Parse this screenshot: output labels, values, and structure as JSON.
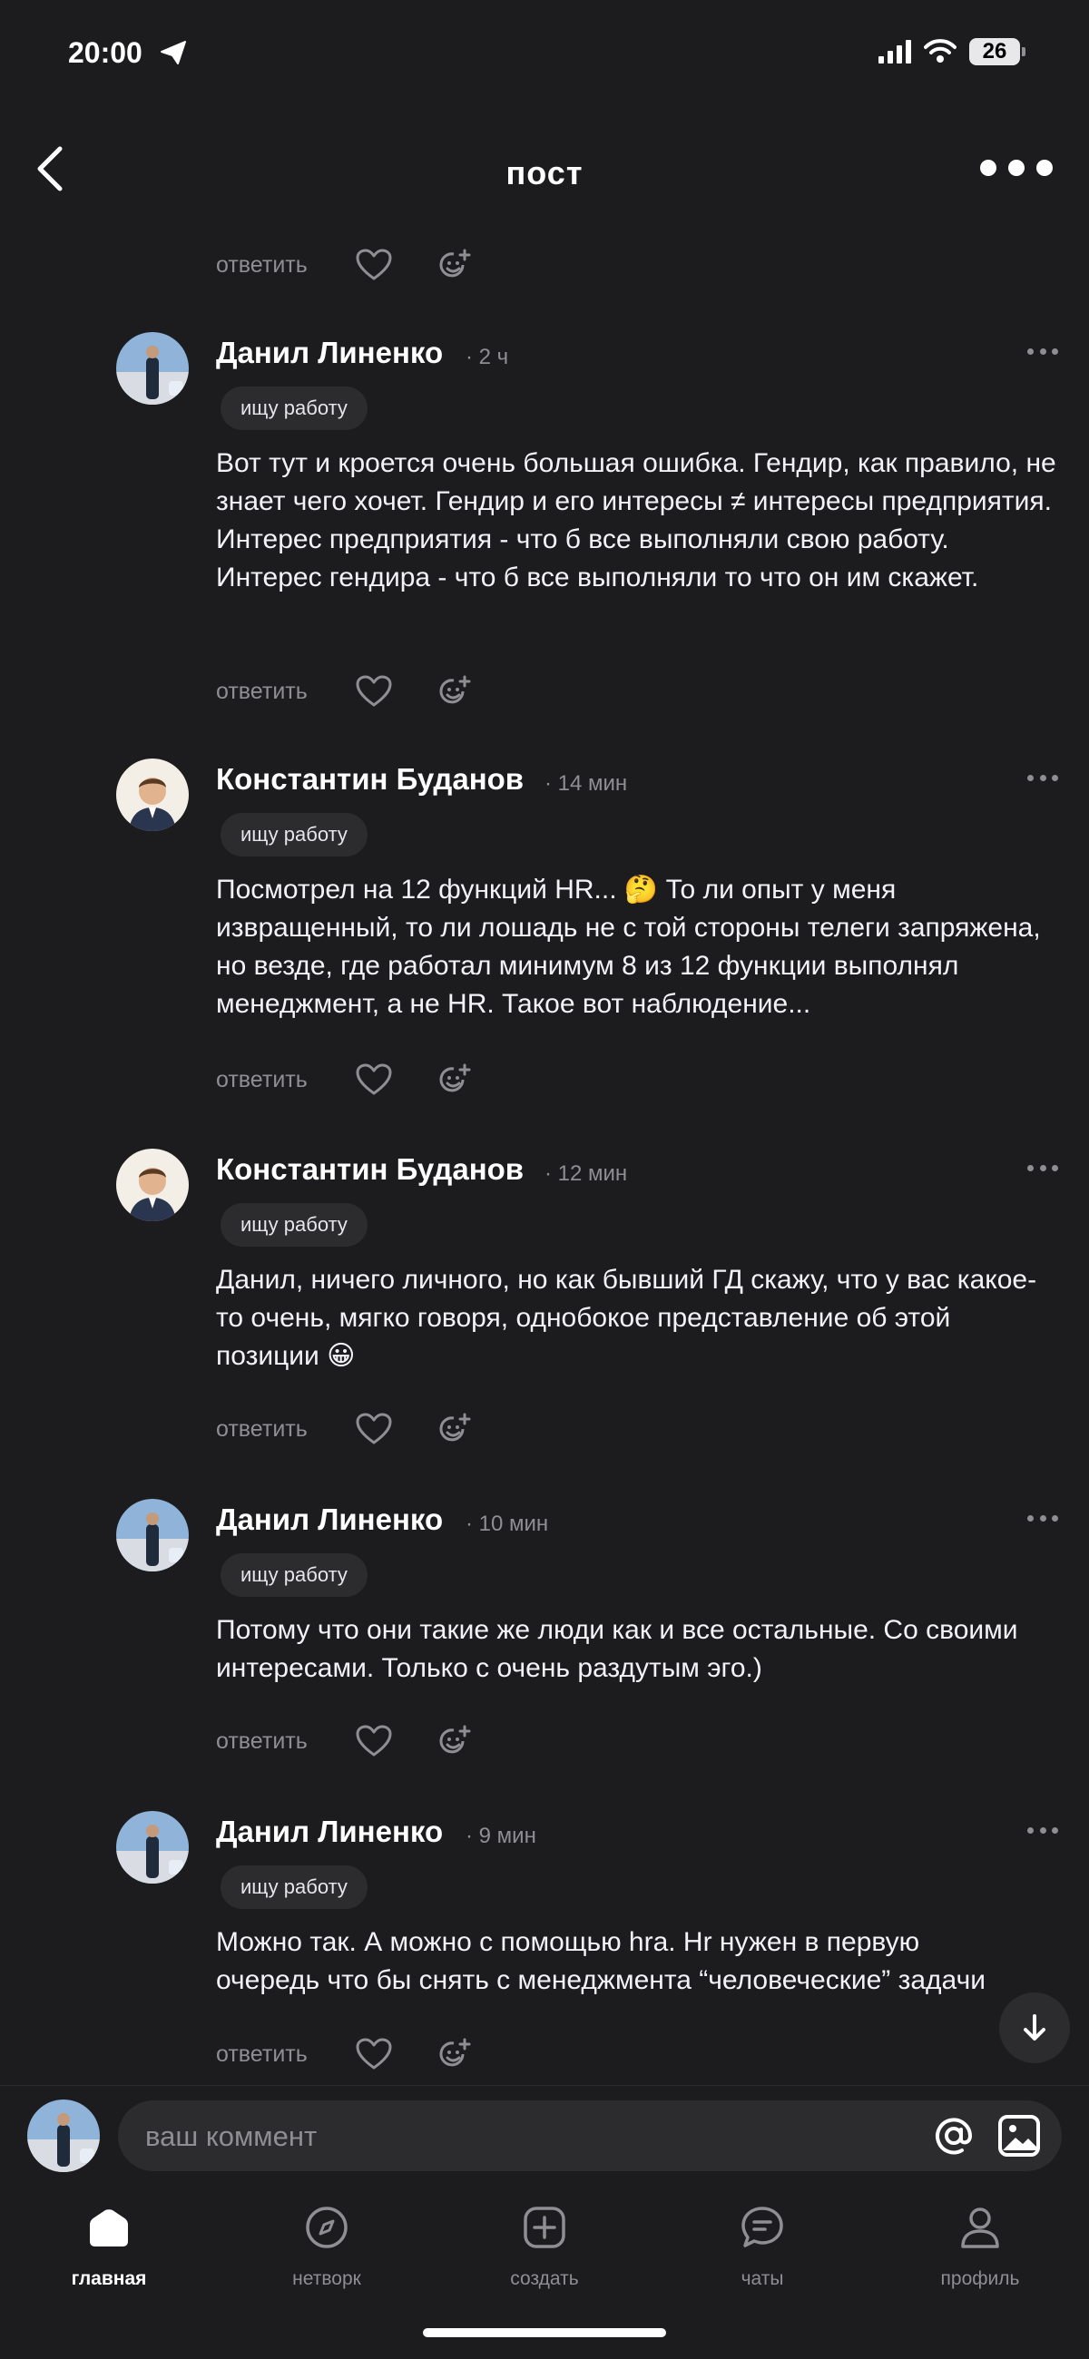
{
  "status_bar": {
    "time": "20:00",
    "battery": "26"
  },
  "nav": {
    "title": "пост"
  },
  "top_actions": {
    "reply": "ответить"
  },
  "comments": [
    {
      "author": "Данил Линенко",
      "time": "· 2 ч",
      "tag": "ищу работу",
      "text": "Вот тут и кроется очень большая ошибка. Гендир, как правило, не знает чего хочет. Гендир и его интересы ≠ интересы предприятия. Интерес предприятия - что б все выполняли свою работу. Интерес гендира - что б все выполняли то что он им скажет.",
      "reply": "ответить"
    },
    {
      "author": "Константин Буданов",
      "time": "· 14 мин",
      "tag": "ищу работу",
      "text": "Посмотрел на 12 функций HR... 🤔 То ли опыт у меня извращенный, то ли лошадь не с той стороны телеги запряжена, но везде, где работал минимум 8 из 12 функции выполнял менеджмент, а не HR. Такое вот наблюдение...",
      "reply": "ответить"
    },
    {
      "author": "Константин Буданов",
      "time": "· 12 мин",
      "tag": "ищу работу",
      "text": "Данил, ничего личного, но как бывший ГД скажу, что у вас какое-то очень, мягко говоря, однобокое представление об этой позиции 😀",
      "reply": "ответить"
    },
    {
      "author": "Данил Линенко",
      "time": "· 10 мин",
      "tag": "ищу работу",
      "text": "Потому что они такие же люди как и все остальные. Со своими интересами. Только с очень раздутым эго.)",
      "reply": "ответить"
    },
    {
      "author": "Данил Линенко",
      "time": "· 9 мин",
      "tag": "ищу работу",
      "text": "Можно так. А можно с помощью hra. Hr нужен в первую очередь что бы снять с менеджмента “человеческие” задачи",
      "reply": "ответить"
    }
  ],
  "composer": {
    "placeholder": "ваш коммент"
  },
  "tabs": [
    {
      "label": "главная",
      "icon": "home-icon",
      "active": true
    },
    {
      "label": "нетворк",
      "icon": "compass-icon"
    },
    {
      "label": "создать",
      "icon": "plus-square-icon"
    },
    {
      "label": "чаты",
      "icon": "chat-icon"
    },
    {
      "label": "профиль",
      "icon": "person-icon"
    }
  ],
  "colors": {
    "background": "#1c1c1e",
    "secondary_text": "#8e8e93",
    "chip": "#2c2c2e"
  }
}
